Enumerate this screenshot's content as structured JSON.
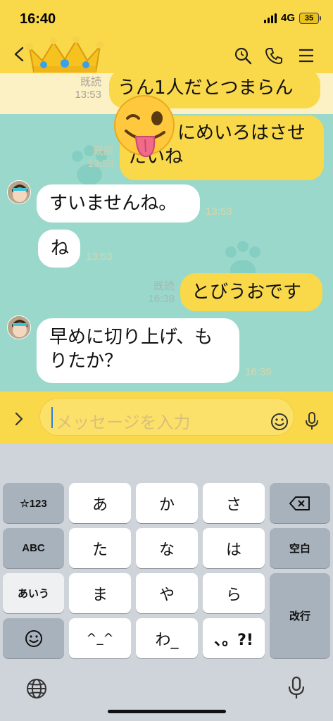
{
  "status_bar": {
    "time": "16:40",
    "network": "4G",
    "battery": "35"
  },
  "header": {
    "icons": [
      "chevron-left-icon",
      "crown-icon",
      "search-icon",
      "phone-icon",
      "menu-icon"
    ],
    "accent": "#f9d84a"
  },
  "messages": [
    {
      "sender": "me",
      "text": "うん1人だとつまらん",
      "read": "既読",
      "time": "13:53"
    },
    {
      "sender": "me",
      "text_line1": "にめいろはさせ",
      "text_line2": "たいね",
      "read": "既読",
      "time": "13:53"
    },
    {
      "sender": "them",
      "text": "すいませんね。",
      "time": "13:53"
    },
    {
      "sender": "them",
      "text": "ね",
      "time": "13:53"
    },
    {
      "sender": "me",
      "text": "とびうおです",
      "read": "既読",
      "time": "16:38"
    },
    {
      "sender": "them",
      "text_line1": "早めに切り上げ、も",
      "text_line2": "りたか？",
      "time": "16:39"
    }
  ],
  "input": {
    "placeholder": "メッセージを入力"
  },
  "keyboard": {
    "row1": [
      "☆123",
      "あ",
      "か",
      "さ"
    ],
    "row2": [
      "ABC",
      "た",
      "な",
      "は",
      "空白"
    ],
    "row3": [
      "あいう",
      "ま",
      "や",
      "ら",
      "改行"
    ],
    "row4": [
      "^_^",
      "わ_",
      "、。?!"
    ],
    "icons": [
      "backspace-icon",
      "emoji-icon",
      "globe-icon",
      "microphone-icon"
    ]
  },
  "colors": {
    "chat_bg": "#9bd8cc",
    "my_bubble": "#f9d84a",
    "their_bubble": "#ffffff",
    "keyboard_bg": "#cfd4da"
  }
}
